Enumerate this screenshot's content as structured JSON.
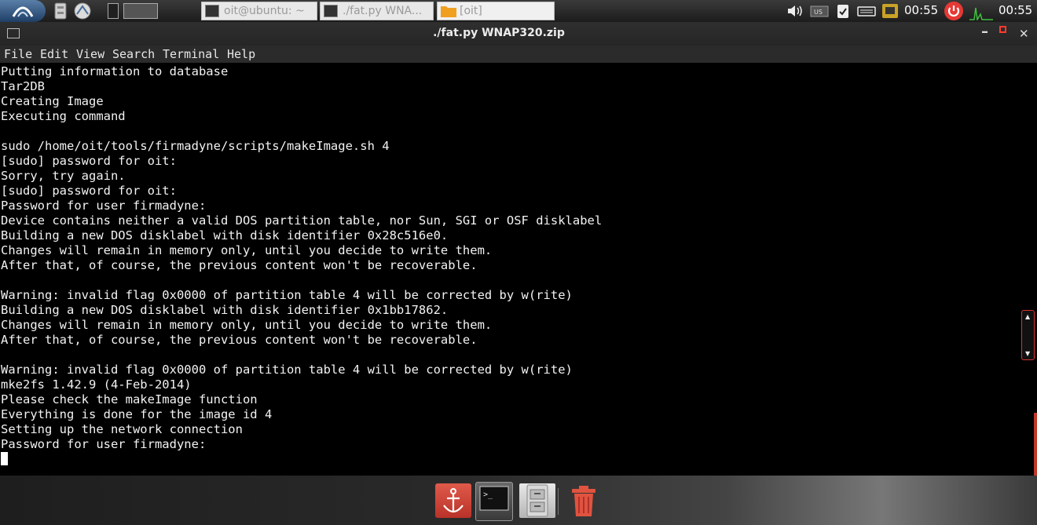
{
  "panel": {
    "tasks": [
      {
        "label": "oit@ubuntu: ~"
      },
      {
        "label": "./fat.py WNA..."
      },
      {
        "label": "[oit]"
      }
    ],
    "clock_1": "00:55",
    "clock_2": "00:55",
    "accent_color": "#e53935"
  },
  "window": {
    "title": "./fat.py WNAP320.zip",
    "menu": [
      "File",
      "Edit",
      "View",
      "Search",
      "Terminal",
      "Help"
    ]
  },
  "terminal": {
    "lines": [
      "Putting information to database",
      "Tar2DB",
      "Creating Image",
      "Executing command",
      "",
      "sudo /home/oit/tools/firmadyne/scripts/makeImage.sh 4",
      "[sudo] password for oit:",
      "Sorry, try again.",
      "[sudo] password for oit:",
      "Password for user firmadyne:",
      "Device contains neither a valid DOS partition table, nor Sun, SGI or OSF disklabel",
      "Building a new DOS disklabel with disk identifier 0x28c516e0.",
      "Changes will remain in memory only, until you decide to write them.",
      "After that, of course, the previous content won't be recoverable.",
      "",
      "Warning: invalid flag 0x0000 of partition table 4 will be corrected by w(rite)",
      "Building a new DOS disklabel with disk identifier 0x1bb17862.",
      "Changes will remain in memory only, until you decide to write them.",
      "After that, of course, the previous content won't be recoverable.",
      "",
      "Warning: invalid flag 0x0000 of partition table 4 will be corrected by w(rite)",
      "mke2fs 1.42.9 (4-Feb-2014)",
      "Please check the makeImage function",
      "Everything is done for the image id 4",
      "Setting up the network connection",
      "Password for user firmadyne:"
    ]
  },
  "dock": {
    "items": [
      "anchor-icon",
      "terminal-icon",
      "file-cabinet-icon",
      "trash-icon"
    ]
  }
}
